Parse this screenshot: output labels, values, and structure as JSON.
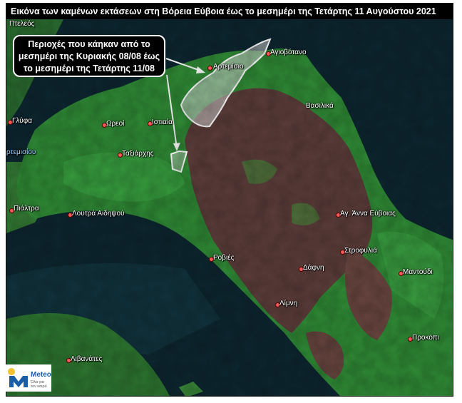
{
  "title": "Εικόνα των καμένων εκτάσεων στη Βόρεια Εύβοια  έως το μεσημέρι της Τετάρτης 11 Αυγούστου 2021",
  "callout": {
    "line1": "Περιοχές που κάηκαν  από το",
    "line2": "μεσημέρι της Κυριακής 08/08 έως",
    "line3": "το μεσημέρι της Τετάρτης 11/08"
  },
  "places": {
    "ptelos": "Πτελεός",
    "artemisio": "Αρτεμίσιο",
    "agiovotano": "Αγιοβότανο",
    "vasilika": "Βασιλικά",
    "glyfa": "Γλύφα",
    "oreoi": "Ωρεοί",
    "istiaia": "Ιστιαία",
    "artemisiou_strait": "ρτεμισίου",
    "taxiarchis": "Ταξιάρχης",
    "pilatra": "Πιάλτρα",
    "loutra": "Λουτρά Αιδηψού",
    "agia_anna": "Αγ. Άννα Εύβοιας",
    "rovies": "Ροβιές",
    "strofylia": "Στροφυλιά",
    "dafni": "Δάφνη",
    "mantoudi": "Μαντούδι",
    "limni": "Λίμνη",
    "prokopi": "Προκόπι",
    "livanates": "Λιβανάτες"
  },
  "logo": {
    "brand": "Meteo",
    "tagline_1": "Όλα για",
    "tagline_2": "τον καιρό"
  },
  "colors": {
    "sea": "#0d2630",
    "vegetation": "#2f8a35",
    "burned": "#5c3d3a",
    "burn_marker": "#ff5a5a",
    "logo_blue": "#1b5ea8",
    "logo_yellow": "#f2c12e"
  }
}
